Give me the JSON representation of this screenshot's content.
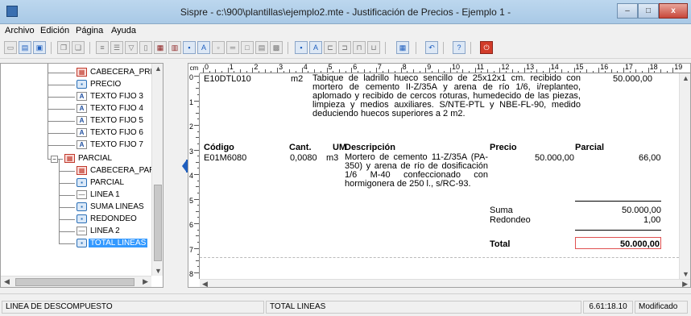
{
  "window": {
    "title": "Sispre - c:\\900\\plantillas\\ejemplo2.mte - Justificación de Precios - Ejemplo 1 -",
    "min_label": "–",
    "max_label": "□",
    "close_label": "x"
  },
  "menu": {
    "archivo": "Archivo",
    "edicion": "Edición",
    "pagina": "Página",
    "ayuda": "Ayuda"
  },
  "tree": {
    "nodes": [
      {
        "label": "CABECERA_PRECI",
        "icon": "table-icon"
      },
      {
        "label": "PRECIO",
        "icon": "field-icon"
      },
      {
        "label": "TEXTO FIJO 3",
        "icon": "text-icon"
      },
      {
        "label": "TEXTO FIJO 4",
        "icon": "text-icon"
      },
      {
        "label": "TEXTO FIJO 5",
        "icon": "text-icon"
      },
      {
        "label": "TEXTO FIJO 6",
        "icon": "text-icon"
      },
      {
        "label": "TEXTO FIJO 7",
        "icon": "text-icon"
      },
      {
        "label": "PARCIAL",
        "icon": "table-icon"
      },
      {
        "label": "CABECERA_PARCI",
        "icon": "table-icon"
      },
      {
        "label": "PARCIAL",
        "icon": "field-icon"
      },
      {
        "label": "LINEA 1",
        "icon": "line-icon"
      },
      {
        "label": "SUMA LINEAS",
        "icon": "field-icon"
      },
      {
        "label": "REDONDEO",
        "icon": "field-icon"
      },
      {
        "label": "LINEA 2",
        "icon": "line-icon"
      },
      {
        "label": "TOTAL LINEAS",
        "icon": "field-icon",
        "selected": true
      }
    ]
  },
  "ruler": {
    "unit": "cm",
    "numbers": [
      "0",
      "1",
      "2",
      "3",
      "4",
      "5",
      "6",
      "7",
      "8",
      "9",
      "10",
      "11",
      "12",
      "13",
      "14",
      "15",
      "16",
      "17",
      "18",
      "19"
    ],
    "vnumbers": [
      "0",
      "1",
      "2",
      "3",
      "4",
      "5",
      "6",
      "7",
      "8"
    ]
  },
  "document": {
    "code": "E10DTL010",
    "unit": "m2",
    "description": "Tabique de ladrillo hueco sencillo de 25x12x1 cm. recibido con mortero de cemento II-Z/35A y arena de río 1/6, i/replanteo, aplomado y recibido de cercos roturas, humedecido de las piezas, limpieza y medios auxiliares. S/NTE-PTL y NBE-FL-90, medido deduciendo huecos superiores a 2 m2.",
    "price": "50.000,00",
    "headers": {
      "codigo": "Código",
      "cant": "Cant.",
      "um": "UM",
      "descripcion": "Descripción",
      "precio": "Precio",
      "parcial": "Parcial"
    },
    "row": {
      "codigo": "E01M6080",
      "cant": "0,0080",
      "um": "m3",
      "descripcion": "Mortero de cemento 11-Z/35A (PA-350) y arena de río de dosificación 1/6 M-40 confeccionado con hormigonera de 250 l., s/RC-93.",
      "precio": "50.000,00",
      "parcial": "66,00"
    },
    "suma_label": "Suma",
    "suma_value": "50.000,00",
    "redondeo_label": "Redondeo",
    "redondeo_value": "1,00",
    "total_label": "Total",
    "total_value": "50.000,00"
  },
  "status": {
    "left": "LINEA DE DESCOMPUESTO",
    "middle": "TOTAL LINEAS",
    "coords": "6.61:18.10",
    "state": "Modificado"
  }
}
